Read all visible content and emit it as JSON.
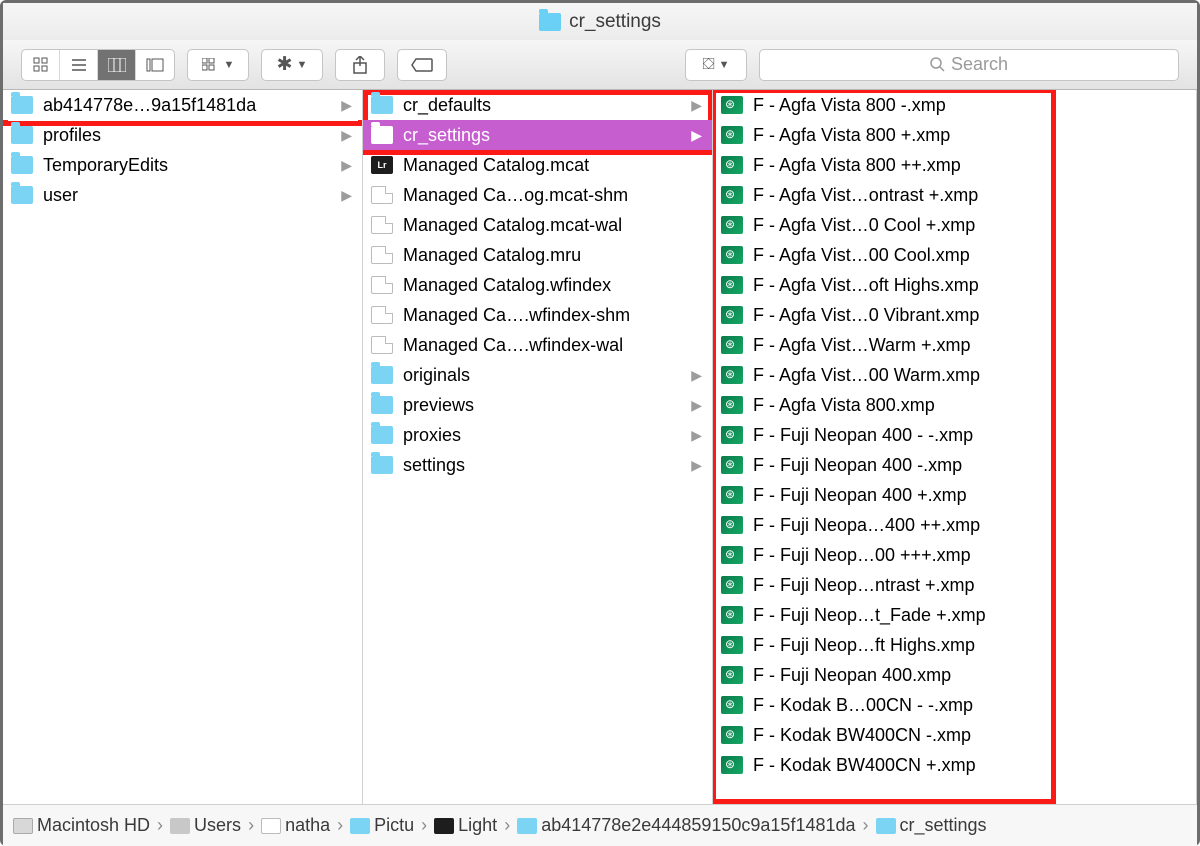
{
  "title": "cr_settings",
  "search": {
    "placeholder": "Search"
  },
  "col1": [
    {
      "t": "folder",
      "n": "ab414778e…9a15f1481da",
      "chev": true,
      "sel": "red"
    },
    {
      "t": "folder",
      "n": "profiles",
      "chev": true
    },
    {
      "t": "folder",
      "n": "TemporaryEdits",
      "chev": true
    },
    {
      "t": "folder",
      "n": "user",
      "chev": true
    }
  ],
  "col2": [
    {
      "t": "folder",
      "n": "cr_defaults",
      "chev": true
    },
    {
      "t": "folder",
      "n": "cr_settings",
      "chev": true,
      "sel": "purp"
    },
    {
      "t": "lrcat",
      "n": "Managed Catalog.mcat"
    },
    {
      "t": "doc",
      "n": "Managed Ca…og.mcat-shm"
    },
    {
      "t": "doc",
      "n": "Managed Catalog.mcat-wal"
    },
    {
      "t": "doc",
      "n": "Managed Catalog.mru"
    },
    {
      "t": "doc",
      "n": "Managed Catalog.wfindex"
    },
    {
      "t": "doc",
      "n": "Managed Ca….wfindex-shm"
    },
    {
      "t": "doc",
      "n": "Managed Ca….wfindex-wal"
    },
    {
      "t": "folder",
      "n": "originals",
      "chev": true
    },
    {
      "t": "folder",
      "n": "previews",
      "chev": true
    },
    {
      "t": "folder",
      "n": "proxies",
      "chev": true
    },
    {
      "t": "folder",
      "n": "settings",
      "chev": true
    }
  ],
  "col3": [
    {
      "t": "xmp",
      "n": "F - Agfa Vista 800 -.xmp"
    },
    {
      "t": "xmp",
      "n": "F - Agfa Vista 800 +.xmp"
    },
    {
      "t": "xmp",
      "n": "F - Agfa Vista 800 ++.xmp"
    },
    {
      "t": "xmp",
      "n": "F - Agfa Vist…ontrast +.xmp"
    },
    {
      "t": "xmp",
      "n": "F - Agfa Vist…0 Cool +.xmp"
    },
    {
      "t": "xmp",
      "n": "F - Agfa Vist…00 Cool.xmp"
    },
    {
      "t": "xmp",
      "n": "F - Agfa Vist…oft Highs.xmp"
    },
    {
      "t": "xmp",
      "n": "F - Agfa Vist…0 Vibrant.xmp"
    },
    {
      "t": "xmp",
      "n": "F - Agfa Vist…Warm +.xmp"
    },
    {
      "t": "xmp",
      "n": "F - Agfa Vist…00 Warm.xmp"
    },
    {
      "t": "xmp",
      "n": "F - Agfa Vista 800.xmp"
    },
    {
      "t": "xmp",
      "n": "F - Fuji Neopan 400 - -.xmp"
    },
    {
      "t": "xmp",
      "n": "F - Fuji Neopan 400 -.xmp"
    },
    {
      "t": "xmp",
      "n": "F - Fuji Neopan 400 +.xmp"
    },
    {
      "t": "xmp",
      "n": "F - Fuji Neopa…400 ++.xmp"
    },
    {
      "t": "xmp",
      "n": "F - Fuji Neop…00 +++.xmp"
    },
    {
      "t": "xmp",
      "n": "F - Fuji Neop…ntrast +.xmp"
    },
    {
      "t": "xmp",
      "n": "F - Fuji Neop…t_Fade +.xmp"
    },
    {
      "t": "xmp",
      "n": "F - Fuji Neop…ft Highs.xmp"
    },
    {
      "t": "xmp",
      "n": "F - Fuji Neopan 400.xmp"
    },
    {
      "t": "xmp",
      "n": "F - Kodak B…00CN - -.xmp"
    },
    {
      "t": "xmp",
      "n": "F - Kodak BW400CN -.xmp"
    },
    {
      "t": "xmp",
      "n": "F - Kodak BW400CN +.xmp"
    }
  ],
  "path": [
    {
      "ic": "phd",
      "n": "Macintosh HD"
    },
    {
      "ic": "pusers",
      "n": "Users"
    },
    {
      "ic": "phome",
      "n": "natha"
    },
    {
      "ic": "pfolder",
      "n": "Pictu"
    },
    {
      "ic": "plr",
      "n": "Light"
    },
    {
      "ic": "pfolder",
      "n": "ab414778e2e444859150c9a15f1481da"
    },
    {
      "ic": "pfolder",
      "n": "cr_settings"
    }
  ]
}
